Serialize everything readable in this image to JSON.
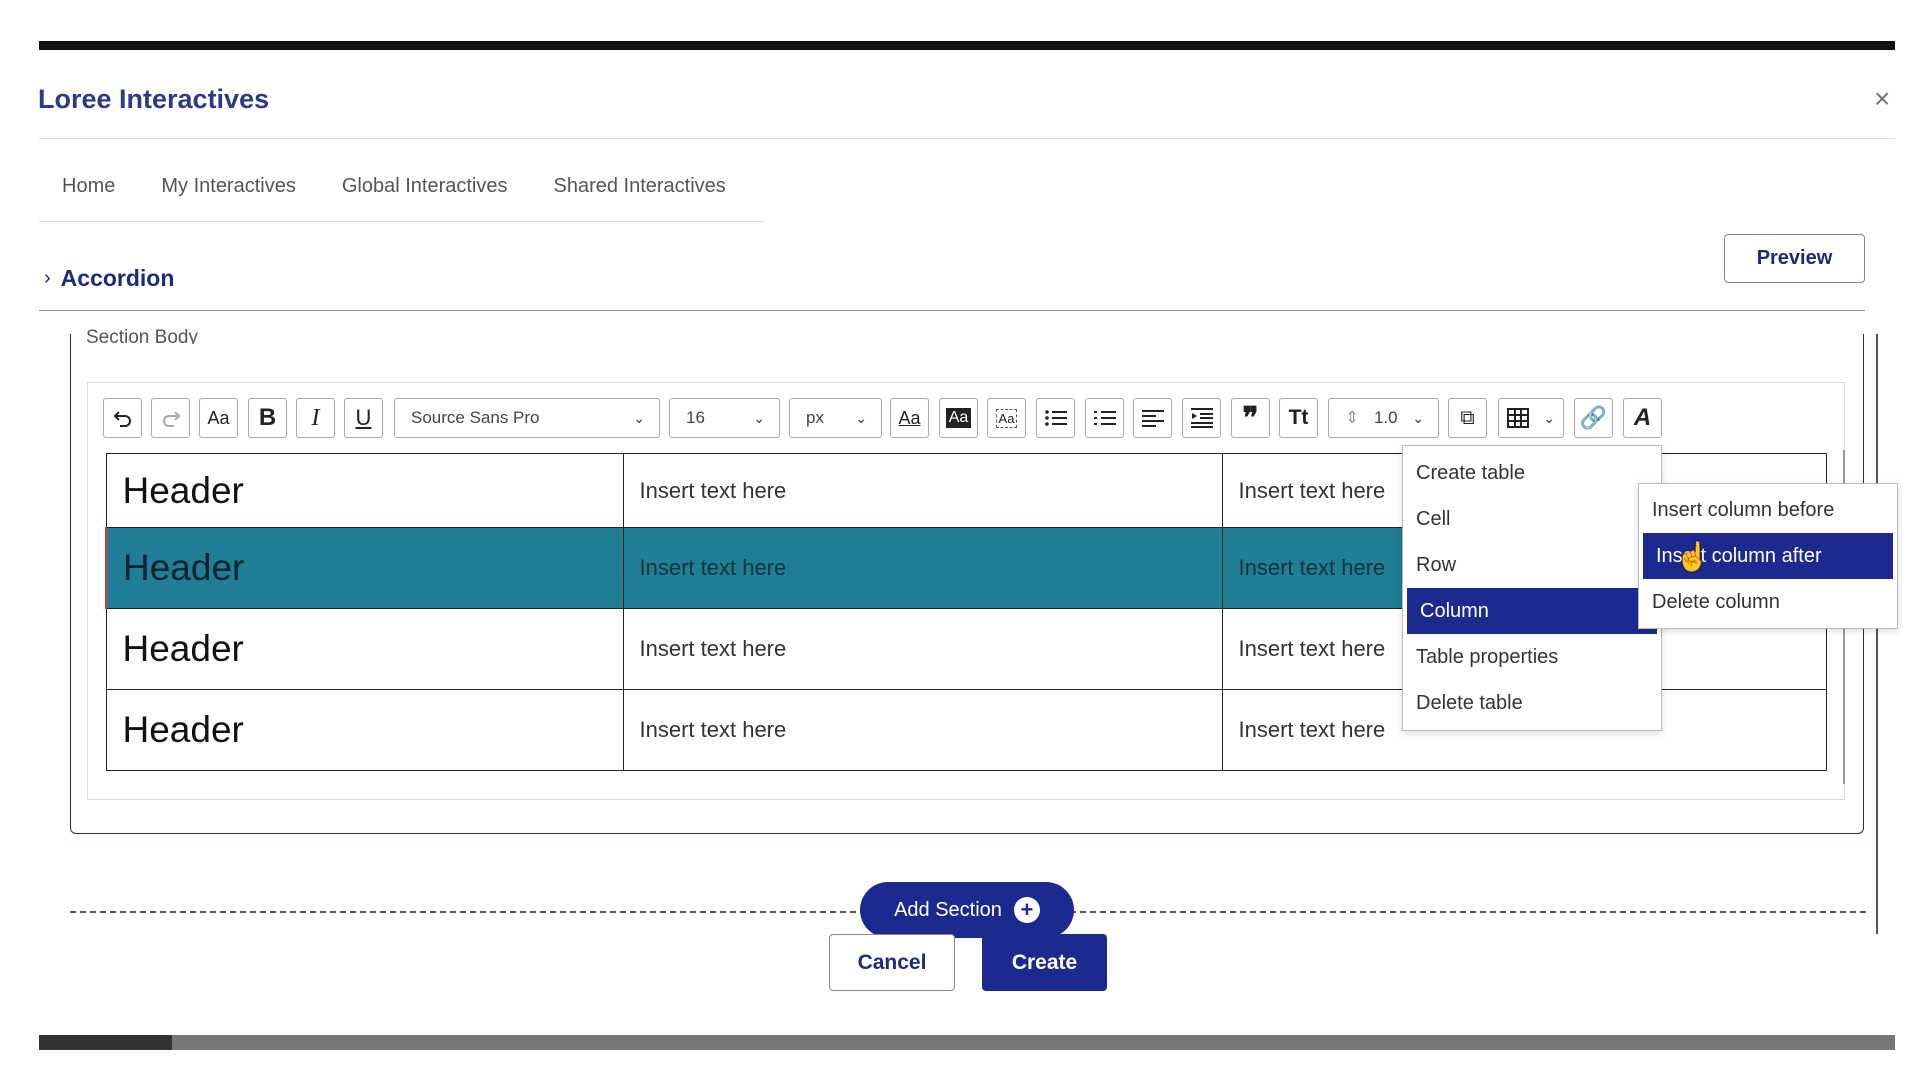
{
  "app": {
    "title": "Loree Interactives",
    "close_label": "×"
  },
  "tabs": [
    {
      "label": "Home"
    },
    {
      "label": "My Interactives"
    },
    {
      "label": "Global Interactives"
    },
    {
      "label": "Shared Interactives"
    }
  ],
  "accordion": {
    "label": "Accordion",
    "preview_label": "Preview",
    "section_label": "Section Body"
  },
  "toolbar": {
    "font_family": "Source Sans Pro",
    "font_size": "16",
    "unit": "px",
    "line_height": "1.0",
    "icons": [
      "undo-icon",
      "redo-icon",
      "font-case-icon",
      "bold-icon",
      "italic-icon",
      "underline-icon",
      "text-color-icon",
      "highlight-icon",
      "clear-format-icon",
      "bulleted-list-icon",
      "numbered-list-icon",
      "align-left-icon",
      "indent-icon",
      "quote-icon",
      "text-transform-icon",
      "line-height-icon",
      "special-char-icon",
      "table-icon",
      "link-icon",
      "text-style-icon"
    ]
  },
  "table": {
    "rows": [
      [
        "Header",
        "Insert text here",
        "Insert text here"
      ],
      [
        "Header",
        "Insert text here",
        "Insert text here"
      ],
      [
        "Header",
        "Insert text here",
        "Insert text here"
      ],
      [
        "Header",
        "Insert text here",
        "Insert text here"
      ]
    ],
    "selected_row": 1
  },
  "table_menu": {
    "items": [
      "Create table",
      "Cell",
      "Row",
      "Column",
      "Table properties",
      "Delete table"
    ],
    "active": "Column"
  },
  "column_submenu": {
    "items": [
      "Insert column before",
      "Insert column after",
      "Delete column"
    ],
    "active": "Insert column after"
  },
  "footer": {
    "add_section_label": "Add Section",
    "cancel_label": "Cancel",
    "create_label": "Create"
  },
  "colors": {
    "brand": "#1c2a8f",
    "selected_row": "#1f7d94"
  }
}
